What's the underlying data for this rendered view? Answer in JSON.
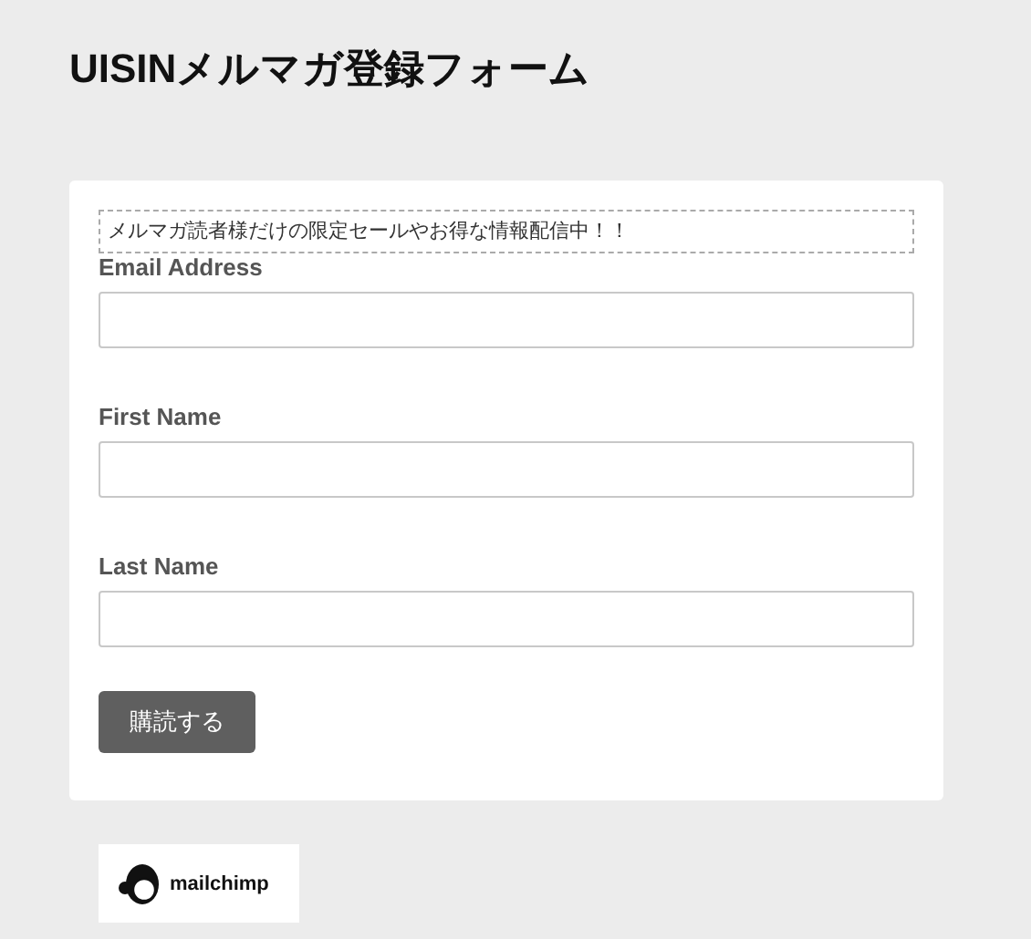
{
  "title": "UISINメルマガ登録フォーム",
  "form": {
    "notice": "メルマガ読者様だけの限定セールやお得な情報配信中！！",
    "fields": [
      {
        "label": "Email Address"
      },
      {
        "label": "First Name"
      },
      {
        "label": "Last Name"
      }
    ],
    "submit": "購読する"
  },
  "badge": {
    "text": "mailchimp"
  }
}
